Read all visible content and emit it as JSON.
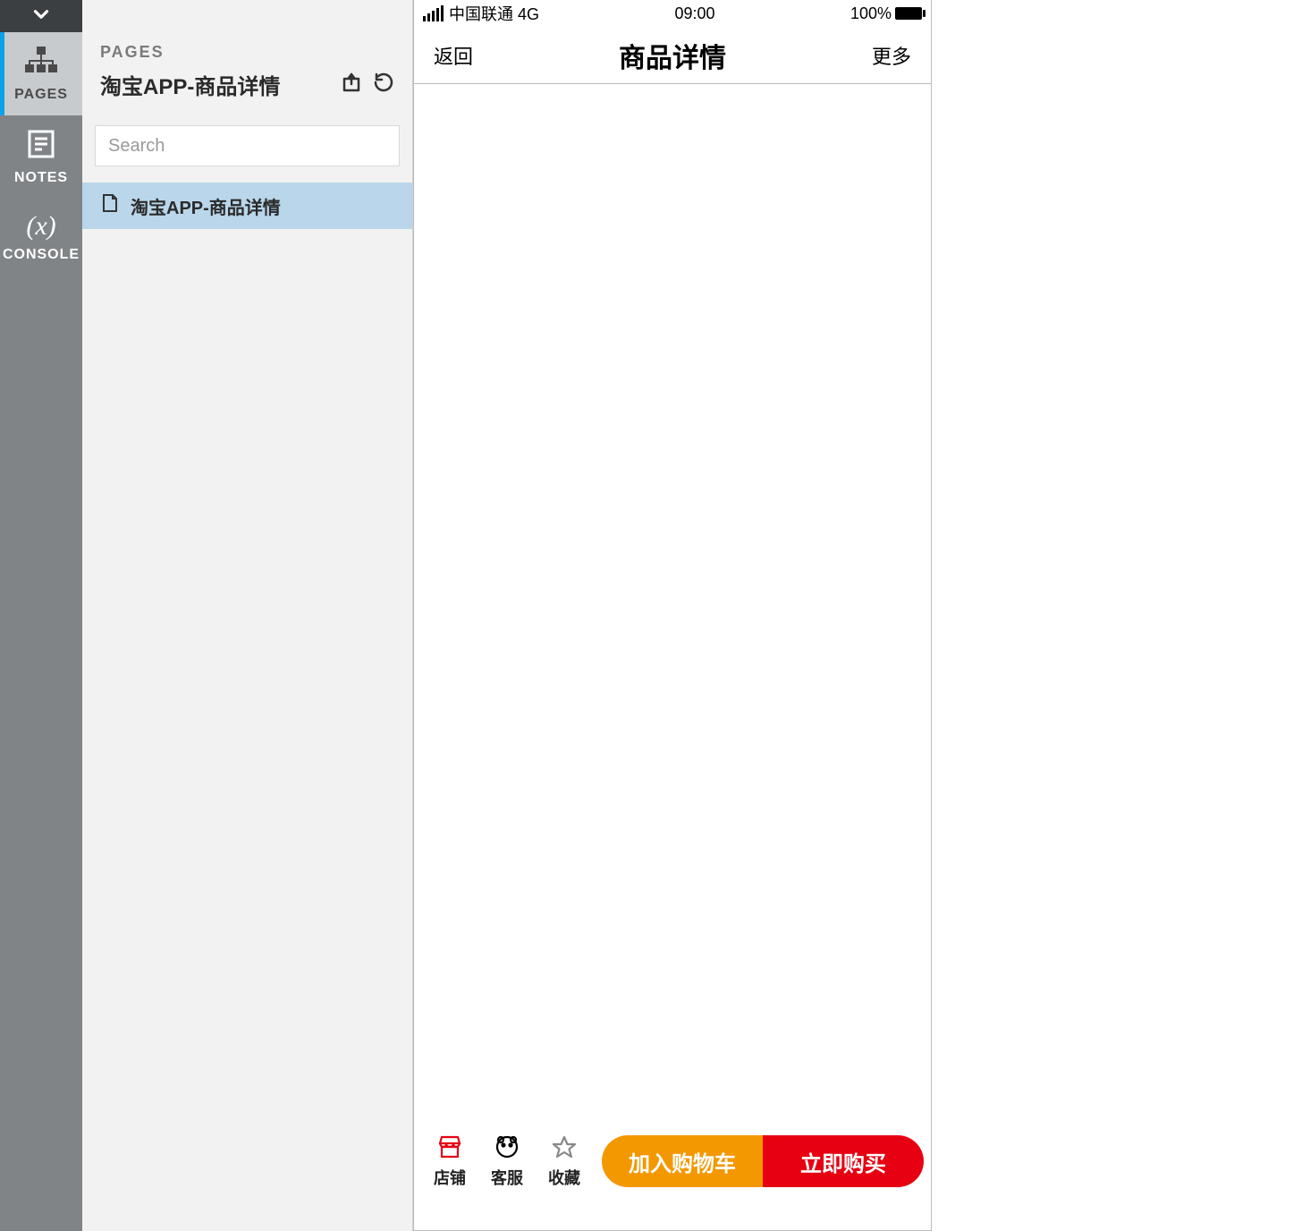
{
  "rail": {
    "items": [
      {
        "id": "pages",
        "label": "PAGES",
        "active": true
      },
      {
        "id": "notes",
        "label": "NOTES",
        "active": false
      },
      {
        "id": "console",
        "label": "CONSOLE",
        "active": false
      }
    ]
  },
  "panel": {
    "eyebrow": "PAGES",
    "title": "淘宝APP-商品详情",
    "search_placeholder": "Search",
    "pages": [
      {
        "label": "淘宝APP-商品详情",
        "selected": true
      }
    ]
  },
  "device": {
    "statusbar": {
      "carrier": "中国联通 4G",
      "time": "09:00",
      "battery": "100%"
    },
    "navbar": {
      "back": "返回",
      "title": "商品详情",
      "more": "更多"
    },
    "bottombar": {
      "shop": "店铺",
      "service": "客服",
      "favorite": "收藏",
      "add_cart": "加入购物车",
      "buy_now": "立即购买"
    }
  }
}
